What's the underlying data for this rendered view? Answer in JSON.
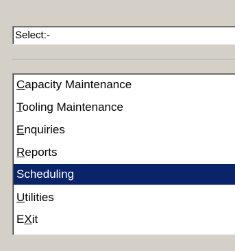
{
  "select": {
    "value": "Select:-"
  },
  "menu": {
    "items": [
      {
        "accel": "C",
        "rest": "apacity Maintenance",
        "prefix": "",
        "selected": false
      },
      {
        "accel": "T",
        "rest": "ooling Maintenance",
        "prefix": "",
        "selected": false
      },
      {
        "accel": "E",
        "rest": "nquiries",
        "prefix": "",
        "selected": false
      },
      {
        "accel": "R",
        "rest": "eports",
        "prefix": "",
        "selected": false
      },
      {
        "accel": "",
        "rest": "Scheduling",
        "prefix": "",
        "selected": true
      },
      {
        "accel": "U",
        "rest": "tilities",
        "prefix": "",
        "selected": false
      },
      {
        "accel": "X",
        "rest": "it",
        "prefix": "E",
        "selected": false
      }
    ]
  },
  "colors": {
    "face": "#d4d0c8",
    "highlight": "#0a246a",
    "highlight_text": "#ffffff"
  }
}
